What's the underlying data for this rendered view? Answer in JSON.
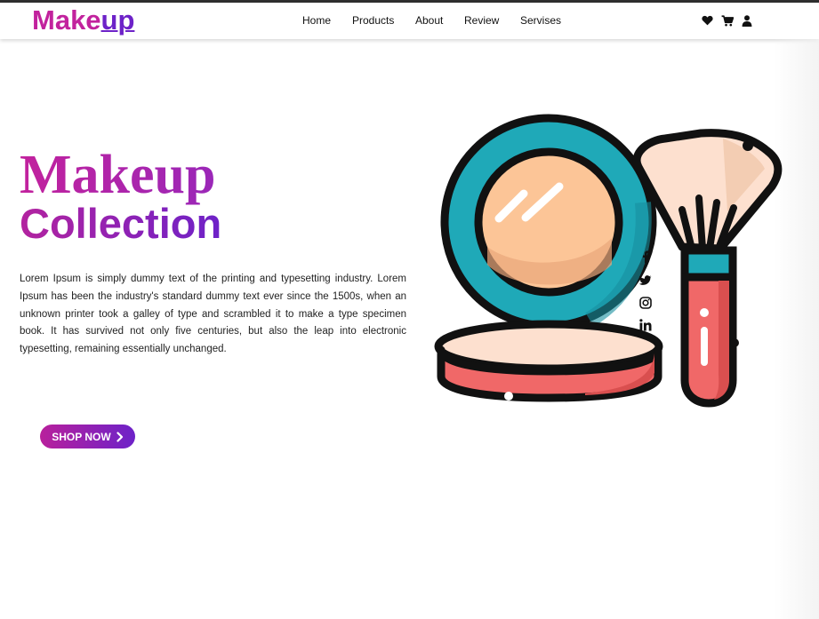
{
  "brand": {
    "part1": "Make",
    "part2": "up"
  },
  "nav": {
    "links": [
      "Home",
      "Products",
      "About",
      "Review",
      "Servises"
    ],
    "icons": [
      "heart-icon",
      "cart-icon",
      "user-icon"
    ]
  },
  "hero": {
    "title_line1": "Makeup",
    "title_line2": "Collection",
    "description": "Lorem Ipsum is simply dummy text of the printing and typesetting industry. Lorem Ipsum has been the industry's standard dummy text ever since the 1500s, when an unknown printer took a galley of type and scrambled it to make a type specimen book. It has survived not only five centuries, but also the leap into electronic typesetting, remaining essentially unchanged.",
    "cta_label": "SHOP NOW"
  },
  "social": [
    "facebook-icon",
    "twitter-icon",
    "instagram-icon",
    "linkedin-icon"
  ],
  "colors": {
    "brand_pink": "#c2229d",
    "brand_purple": "#6d22c8",
    "teal": "#1fa9b8",
    "peach": "#fcc597",
    "coral": "#f06868"
  }
}
